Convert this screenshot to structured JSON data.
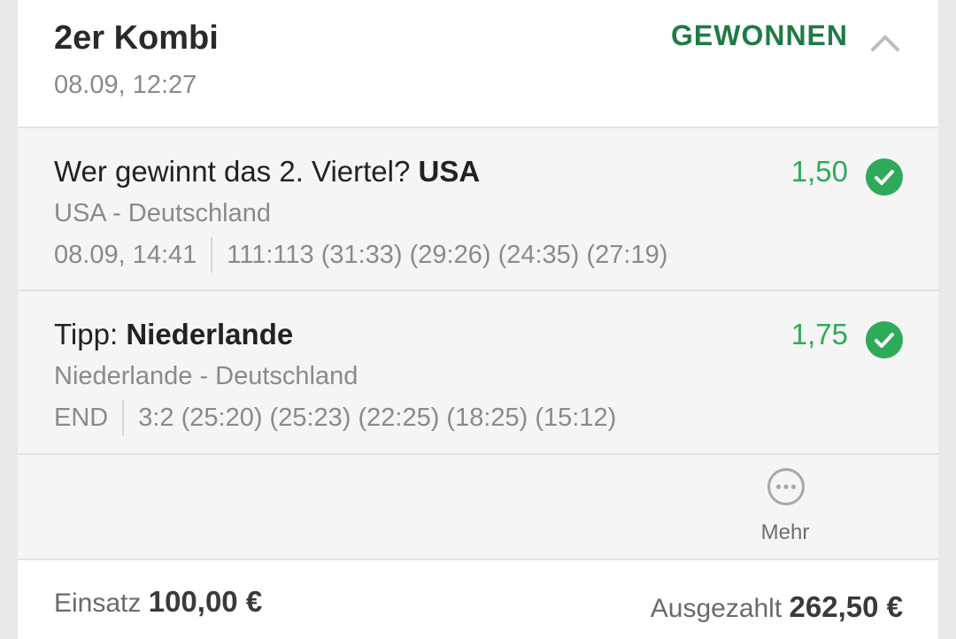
{
  "header": {
    "title": "2er Kombi",
    "date": "08.09, 12:27",
    "status": "GEWONNEN",
    "status_color": "#1f7a46"
  },
  "bets": [
    {
      "question_prefix": "Wer gewinnt das 2. Viertel? ",
      "selection": "USA",
      "match": "USA - Deutschland",
      "meta_left": "08.09, 14:41",
      "meta_right": "111:113 (31:33) (29:26) (24:35) (27:19)",
      "odds": "1,50",
      "result_icon": "check-circle-icon"
    },
    {
      "question_prefix": "Tipp: ",
      "selection": "Niederlande",
      "match": "Niederlande - Deutschland",
      "meta_left": "END",
      "meta_right": "3:2 (25:20) (25:23) (22:25) (18:25) (15:12)",
      "odds": "1,75",
      "result_icon": "check-circle-icon"
    }
  ],
  "more": {
    "label": "Mehr",
    "icon": "more-dots-icon"
  },
  "footer": {
    "stake_label": "Einsatz ",
    "stake_value": "100,00 €",
    "payout_label": "Ausgezahlt ",
    "payout_value": "262,50 €"
  },
  "colors": {
    "win_green": "#2faa5a",
    "accent_dark_green": "#1f7a46"
  }
}
